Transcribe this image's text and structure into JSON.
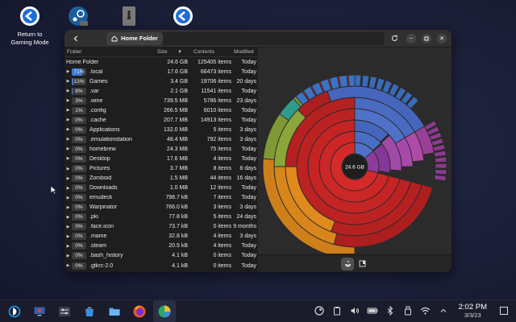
{
  "desktop": {
    "icons": [
      {
        "label_line1": "Return to",
        "label_line2": "Gaming Mode"
      },
      {
        "label_line1": "",
        "label_line2": ""
      },
      {
        "label_line1": "",
        "label_line2": ""
      },
      {
        "label_line1": "",
        "label_line2": ""
      }
    ]
  },
  "window": {
    "breadcrumb": "Home Folder",
    "columns": {
      "folder": "Folder",
      "size": "Size",
      "contents": "Contents",
      "modified": "Modified"
    },
    "root": {
      "name": "Home Folder",
      "size": "24.6 GB",
      "contents": "125405 items",
      "modified": "Today"
    },
    "rows": [
      {
        "pct": "71%",
        "pct_value": 71,
        "name": ".local",
        "size": "17.6 GB",
        "contents": "66473 items",
        "modified": "Today",
        "selected": true
      },
      {
        "pct": "13%",
        "pct_value": 13,
        "name": "Games",
        "size": "3.4 GB",
        "contents": "19706 items",
        "modified": "20 days",
        "selected": true
      },
      {
        "pct": "8%",
        "pct_value": 8,
        "name": ".var",
        "size": "2.1 GB",
        "contents": "11541 items",
        "modified": "Today",
        "selected": true
      },
      {
        "pct": "3%",
        "pct_value": 3,
        "name": ".wine",
        "size": "739.5 MB",
        "contents": "5786 items",
        "modified": "23 days"
      },
      {
        "pct": "1%",
        "pct_value": 1,
        "name": ".config",
        "size": "266.5 MB",
        "contents": "6010 items",
        "modified": "Today"
      },
      {
        "pct": "0%",
        "pct_value": 0,
        "name": ".cache",
        "size": "207.7 MB",
        "contents": "14913 items",
        "modified": "Today"
      },
      {
        "pct": "0%",
        "pct_value": 0,
        "name": "Applications",
        "size": "132.0 MB",
        "contents": "5 items",
        "modified": "3 days"
      },
      {
        "pct": "0%",
        "pct_value": 0,
        "name": ".emulationstation",
        "size": "48.4 MB",
        "contents": "792 items",
        "modified": "3 days"
      },
      {
        "pct": "0%",
        "pct_value": 0,
        "name": "homebrew",
        "size": "24.3 MB",
        "contents": "75 items",
        "modified": "Today"
      },
      {
        "pct": "0%",
        "pct_value": 0,
        "name": "Desktop",
        "size": "17.6 MB",
        "contents": "4 items",
        "modified": "Today"
      },
      {
        "pct": "0%",
        "pct_value": 0,
        "name": "Pictures",
        "size": "3.7 MB",
        "contents": "8 items",
        "modified": "8 days"
      },
      {
        "pct": "0%",
        "pct_value": 0,
        "name": "Zomboid",
        "size": "1.5 MB",
        "contents": "44 items",
        "modified": "16 days"
      },
      {
        "pct": "0%",
        "pct_value": 0,
        "name": "Downloads",
        "size": "1.0 MB",
        "contents": "12 items",
        "modified": "Today"
      },
      {
        "pct": "0%",
        "pct_value": 0,
        "name": "emudeck",
        "size": "798.7 kB",
        "contents": "7 items",
        "modified": "Today"
      },
      {
        "pct": "0%",
        "pct_value": 0,
        "name": "Warpinator",
        "size": "766.0 kB",
        "contents": "3 items",
        "modified": "3 days"
      },
      {
        "pct": "0%",
        "pct_value": 0,
        "name": ".pki",
        "size": "77.8 kB",
        "contents": "5 items",
        "modified": "24 days"
      },
      {
        "pct": "0%",
        "pct_value": 0,
        "name": ".face.icon",
        "size": "73.7 kB",
        "contents": "0 items",
        "modified": "9 months"
      },
      {
        "pct": "0%",
        "pct_value": 0,
        "name": ".mame",
        "size": "32.8 kB",
        "contents": "4 items",
        "modified": "3 days"
      },
      {
        "pct": "0%",
        "pct_value": 0,
        "name": ".steam",
        "size": "20.5 kB",
        "contents": "4 items",
        "modified": "Today"
      },
      {
        "pct": "0%",
        "pct_value": 0,
        "name": ".bash_history",
        "size": "4.1 kB",
        "contents": "0 items",
        "modified": "Today"
      },
      {
        "pct": "0%",
        "pct_value": 0,
        "name": ".gtkrc-2.0",
        "size": "4.1 kB",
        "contents": "0 items",
        "modified": "Today"
      }
    ],
    "chart_center_label": "24.6 GB"
  },
  "taskbar": {
    "time": "2:02 PM",
    "date": "3/3/23"
  },
  "colors": {
    "accent": "#3d7bd6",
    "red": "#d42a2a",
    "green": "#8aa53a",
    "orange": "#e08a1e",
    "blue": "#4f72c8",
    "purple": "#8e3c9c",
    "teal": "#2e9c8c"
  }
}
